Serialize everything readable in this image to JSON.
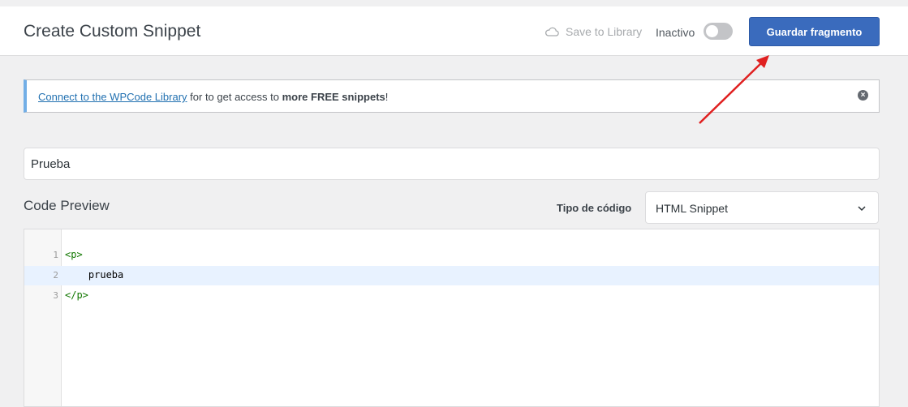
{
  "header": {
    "title": "Create Custom Snippet",
    "save_to_library": "Save to Library",
    "status_label": "Inactivo",
    "toggle_active": false,
    "save_button": "Guardar fragmento"
  },
  "notice": {
    "link_text": "Connect to the WPCode Library",
    "middle_text": " for to get access to ",
    "bold_text": "more FREE snippets",
    "end_text": "!"
  },
  "snippet": {
    "title_value": "Prueba"
  },
  "code_preview": {
    "section_title": "Code Preview",
    "type_label": "Tipo de código",
    "type_value": "HTML Snippet",
    "lines": [
      {
        "num": "1",
        "text": "<p>"
      },
      {
        "num": "2",
        "text": "    prueba"
      },
      {
        "num": "3",
        "text": "</p>"
      }
    ]
  },
  "colors": {
    "primary": "#3a6bbd",
    "notice_border": "#72aee6",
    "annotation_arrow": "#e02020"
  },
  "icons": [
    "cloud-icon",
    "close-icon",
    "chevron-down-icon",
    "annotation-arrow"
  ]
}
